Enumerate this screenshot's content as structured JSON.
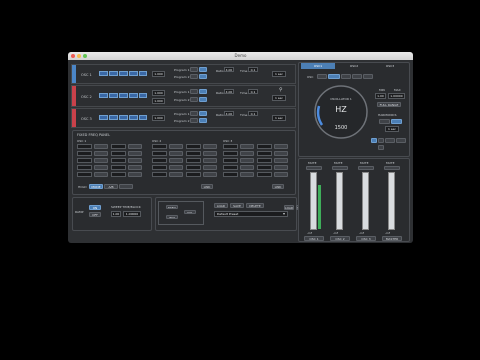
{
  "window": {
    "title": "Demo"
  },
  "osc_rows": [
    {
      "label": "OSC 1",
      "wave_value": "1.000",
      "prog1": "Program 1",
      "prog2": "Program 2",
      "ratio_label": "Ratio",
      "ratio_val": "4.00",
      "time_label": "Time",
      "time_val": "0.1",
      "extra": "1 sec"
    },
    {
      "label": "OSC 2",
      "wave_value": "1.000",
      "sub": "1.000",
      "prog1": "Program 1",
      "prog2": "Program 2",
      "ratio_label": "Ratio",
      "ratio_val": "4.00",
      "time_label": "Time",
      "time_val": "0.1",
      "extra": "1 sec"
    },
    {
      "label": "OSC 3",
      "wave_value": "1.000",
      "prog1": "Program 1",
      "prog2": "Program 2",
      "ratio_label": "Ratio",
      "ratio_val": "4.00",
      "time_label": "Time",
      "time_val": "0.1",
      "extra": "1 sec"
    }
  ],
  "fixed": {
    "title": "FIXED FREQ PANEL",
    "groups": [
      "OSC 1",
      "OSC 2",
      "OSC 3"
    ],
    "hold_label": "HOLD",
    "mode": [
      "MODE",
      "A/B"
    ],
    "apply": "LINK"
  },
  "bottom": {
    "ramp_label": "RAMP",
    "ramp_on": "ON",
    "ramp_off": "OFF",
    "sweep_label": "SWEEP TIME/BLOCK",
    "sweep_a": "1.00",
    "sweep_b": "1.00000",
    "freq_btns": [
      "FREQ",
      "VOL",
      "INIT"
    ],
    "preset_btns": [
      "LOAD",
      "SAVE",
      "DELETE"
    ],
    "preset_value": "Default Preset"
  },
  "right": {
    "tabs": [
      "OSC1",
      "OSC2",
      "OSC3"
    ],
    "osc_label": "OSC",
    "knob_title": "OSCILLATOR 1",
    "knob_unit": "HZ",
    "knob_value": "1500",
    "min_label": "MIN",
    "max_label": "MAX",
    "min_val": "1.00",
    "max_val": "1.00000",
    "full_range": "FULL RANGE",
    "harm_label": "HARMONICS",
    "harm_val": "1 sec",
    "waves": [
      "SIN",
      "SQR",
      "SAW",
      "TRI",
      "NSE",
      "PLS"
    ]
  },
  "mixer": {
    "channels": [
      {
        "mute": "MUTE",
        "db": "-inf",
        "name": "OSC 1"
      },
      {
        "mute": "MUTE",
        "db": "-inf",
        "name": "OSC 2"
      },
      {
        "mute": "MUTE",
        "db": "-inf",
        "name": "OSC 3"
      },
      {
        "mute": "MUTE",
        "db": "-inf",
        "name": "MASTER"
      }
    ]
  },
  "colors": {
    "osc1": "#4b86c7",
    "osc2": "#c9414a",
    "osc3": "#c9414a",
    "accent": "#4c7fb5",
    "meter": "#3fae5a"
  }
}
